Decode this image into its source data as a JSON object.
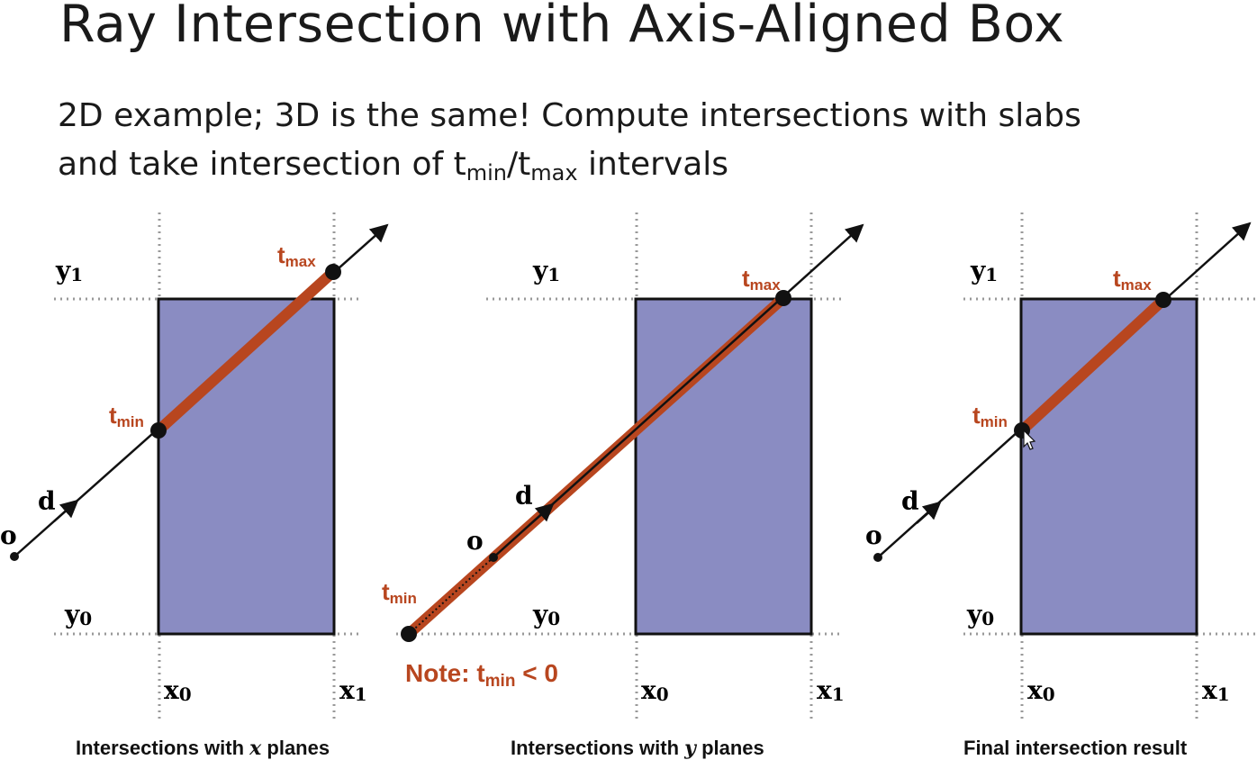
{
  "slide": {
    "title": "Ray Intersection with Axis-Aligned Box",
    "subtitle_line1": "2D example; 3D is the same!  Compute intersections with slabs",
    "subtitle_line2_pre": "and take intersection of t",
    "subtitle_min": "min",
    "subtitle_sep": "/t",
    "subtitle_max": "max",
    "subtitle_line2_post": " intervals"
  },
  "labels": {
    "y1": "y",
    "y1_sub": "1",
    "y0": "y",
    "y0_sub": "0",
    "x0": "x",
    "x0_sub": "0",
    "x1": "x",
    "x1_sub": "1",
    "o": "o",
    "d": "d",
    "t": "t",
    "min": "min",
    "max": "max"
  },
  "panels": [
    {
      "caption_pre": "Intersections with ",
      "caption_var": "x",
      "caption_post": " planes"
    },
    {
      "caption_pre": "Intersections with ",
      "caption_var": "y",
      "caption_post": " planes"
    },
    {
      "caption_pre": "Final intersection result",
      "caption_var": "",
      "caption_post": ""
    }
  ],
  "note": {
    "pre": "Note:  t",
    "sub": "min",
    "post": " < 0"
  },
  "colors": {
    "box_fill": "#8a8cc2",
    "segment": "#b8461f",
    "ray": "#111111",
    "grid": "#999999"
  }
}
